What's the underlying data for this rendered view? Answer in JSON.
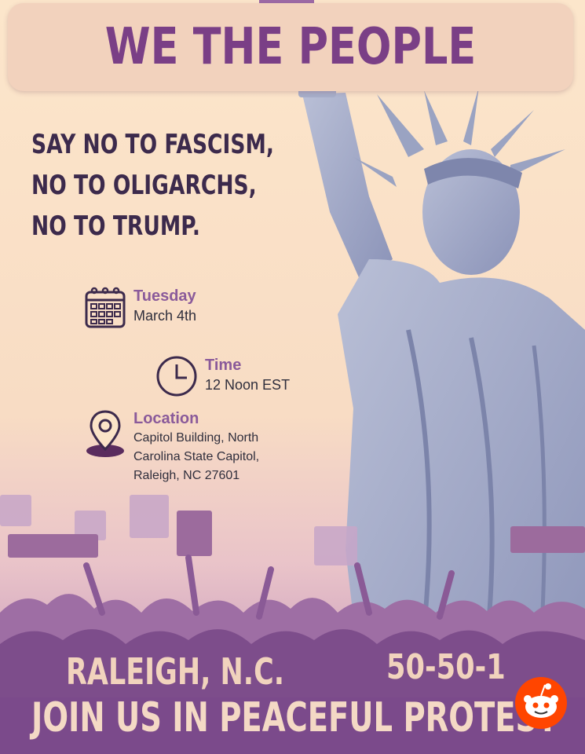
{
  "poster": {
    "title": "WE THE PEOPLE",
    "slogan": [
      "SAY NO TO FASCISM,",
      "NO TO OLIGARCHS,",
      "NO TO TRUMP."
    ],
    "date": {
      "icon": "calendar-icon",
      "label": "Tuesday",
      "value": "March 4th"
    },
    "time": {
      "icon": "clock-icon",
      "label": "Time",
      "value": "12 Noon EST"
    },
    "location": {
      "icon": "map-pin-icon",
      "label": "Location",
      "lines": [
        "Capitol Building, North",
        "Carolina State Capitol,",
        "Raleigh, NC 27601"
      ]
    },
    "city": "RALEIGH, N.C.",
    "code": "50-50-1",
    "call_to_action": "JOIN US IN PEACEFUL PROTEST",
    "colors": {
      "purple": "#7a3f86",
      "dark": "#3c2a4c",
      "background": "#fbe4c8",
      "statue": "#9aa6c4"
    }
  },
  "watermark": {
    "icon": "reddit-icon"
  }
}
